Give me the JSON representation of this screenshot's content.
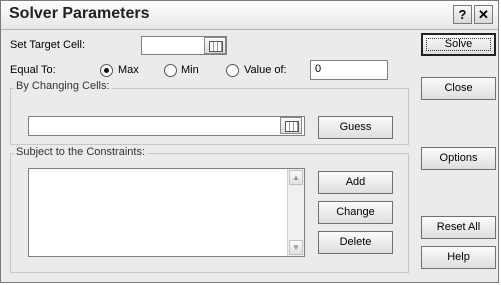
{
  "window": {
    "title": "Solver Parameters",
    "help_glyph": "?",
    "close_glyph": "✕"
  },
  "target": {
    "label": "Set Target Cell:",
    "value": ""
  },
  "equal_to": {
    "label": "Equal To:",
    "options": [
      {
        "label": "Max",
        "selected": true
      },
      {
        "label": "Min",
        "selected": false
      },
      {
        "label": "Value of:",
        "selected": false
      }
    ],
    "value_of": "0"
  },
  "changing": {
    "group_label": "By Changing Cells:",
    "value": "",
    "guess_label": "Guess"
  },
  "constraints": {
    "group_label": "Subject to the Constraints:",
    "items": [],
    "add_label": "Add",
    "change_label": "Change",
    "delete_label": "Delete"
  },
  "side_buttons": {
    "solve": "Solve",
    "close": "Close",
    "options": "Options",
    "reset_all": "Reset All",
    "help": "Help"
  }
}
